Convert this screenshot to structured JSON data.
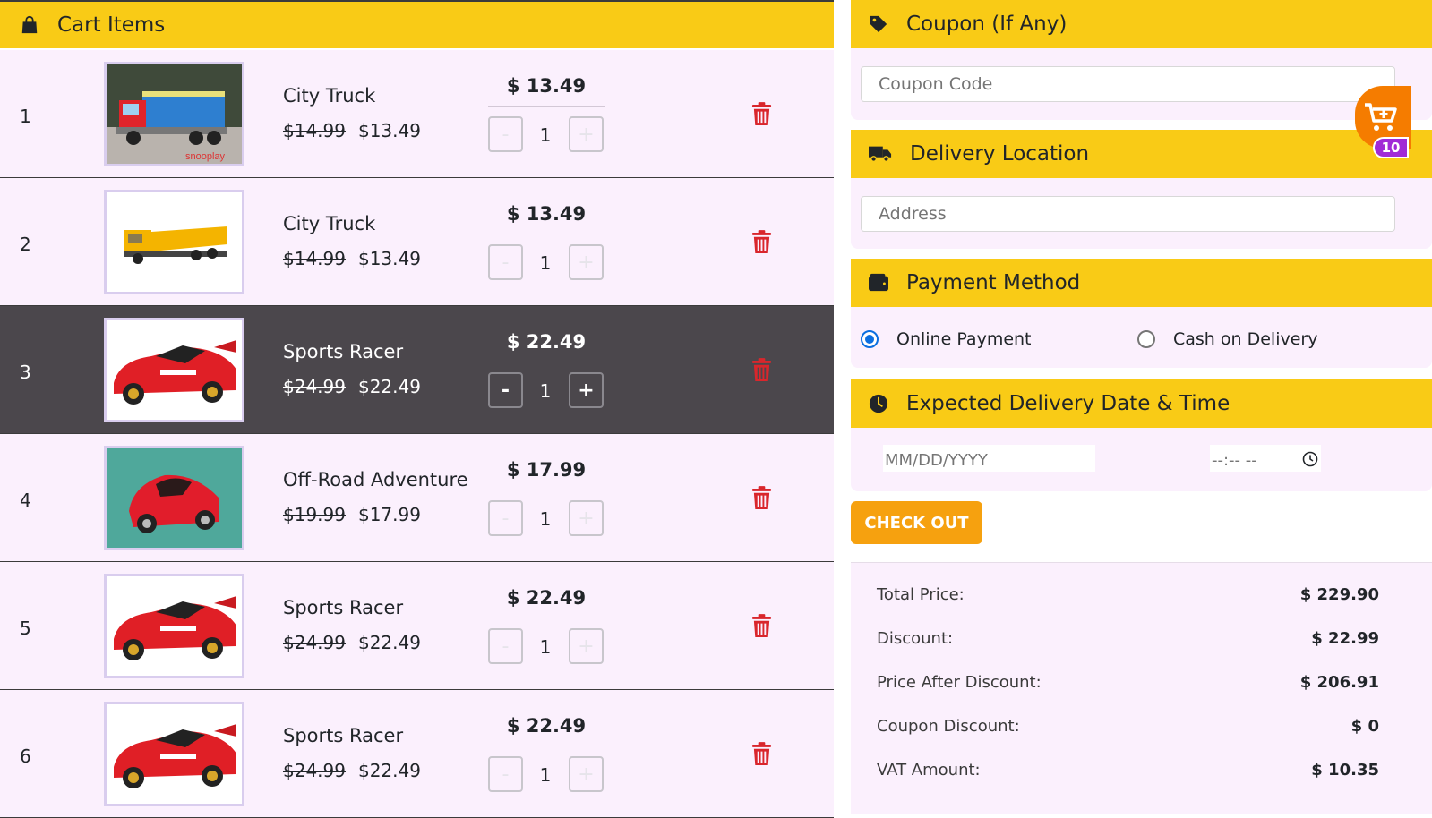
{
  "cart": {
    "title": "Cart Items",
    "header_icon": "shopping-bag-icon",
    "items": [
      {
        "index": "1",
        "name": "City Truck",
        "old_price": "$14.99",
        "price": "$13.49",
        "total": "$ 13.49",
        "qty": "1",
        "minus": "-",
        "plus": "+",
        "image_watermark": "snooplay"
      },
      {
        "index": "2",
        "name": "City Truck",
        "old_price": "$14.99",
        "price": "$13.49",
        "total": "$ 13.49",
        "qty": "1",
        "minus": "-",
        "plus": "+"
      },
      {
        "index": "3",
        "name": "Sports Racer",
        "old_price": "$24.99",
        "price": "$22.49",
        "total": "$ 22.49",
        "qty": "1",
        "minus": "-",
        "plus": "+"
      },
      {
        "index": "4",
        "name": "Off-Road Adventure",
        "old_price": "$19.99",
        "price": "$17.99",
        "total": "$ 17.99",
        "qty": "1",
        "minus": "-",
        "plus": "+"
      },
      {
        "index": "5",
        "name": "Sports Racer",
        "old_price": "$24.99",
        "price": "$22.49",
        "total": "$ 22.49",
        "qty": "1",
        "minus": "-",
        "plus": "+"
      },
      {
        "index": "6",
        "name": "Sports Racer",
        "old_price": "$24.99",
        "price": "$22.49",
        "total": "$ 22.49",
        "qty": "1",
        "minus": "-",
        "plus": "+"
      }
    ],
    "delete_icon": "trash-icon"
  },
  "coupon": {
    "title": "Coupon (If Any)",
    "icon": "tag-icon",
    "placeholder": "Coupon Code"
  },
  "delivery": {
    "title": "Delivery Location",
    "icon": "truck-icon",
    "placeholder": "Address"
  },
  "payment": {
    "title": "Payment Method",
    "icon": "wallet-icon",
    "options": [
      {
        "label": "Online Payment",
        "selected": true
      },
      {
        "label": "Cash on Delivery",
        "selected": false
      }
    ]
  },
  "schedule": {
    "title": "Expected Delivery Date & Time",
    "icon": "clock-icon",
    "date_placeholder": "MM/DD/YYYY",
    "time_placeholder": "--:-- --"
  },
  "checkout_label": "CHECK OUT",
  "summary": [
    {
      "label": "Total Price:",
      "value": "$ 229.90"
    },
    {
      "label": "Discount:",
      "value": "$ 22.99"
    },
    {
      "label": "Price After Discount:",
      "value": "$ 206.91"
    },
    {
      "label": "Coupon Discount:",
      "value": "$ 0"
    },
    {
      "label": "VAT Amount:",
      "value": "$ 10.35"
    }
  ],
  "floating_cart": {
    "icon": "cart-plus-icon",
    "count": "10"
  },
  "colors": {
    "header": "#f9cb16",
    "row_bg": "#fbf0fd",
    "row_active": "#4b474c",
    "checkout": "#f6a10f",
    "trash": "#d9262c",
    "badge": "#a12ad6",
    "cart_button": "#f57c00"
  }
}
